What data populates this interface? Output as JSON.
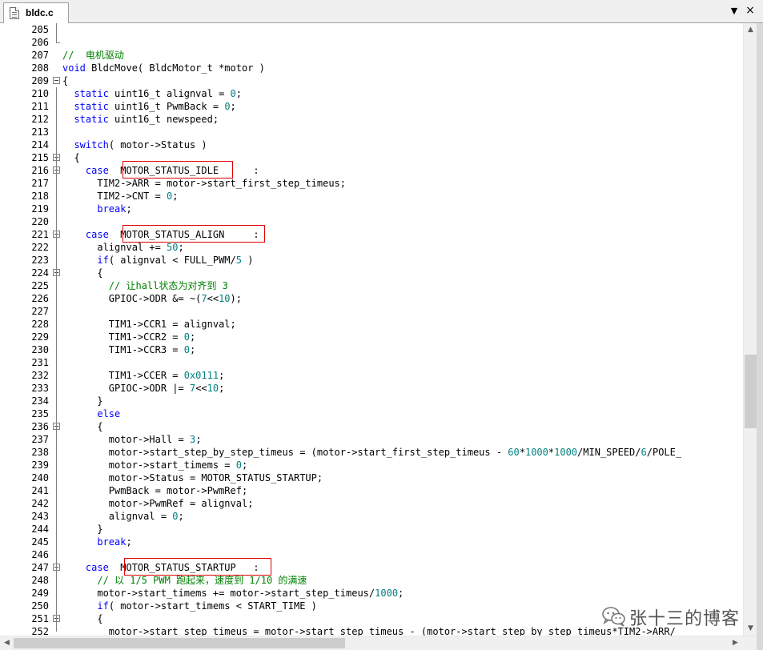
{
  "tab": {
    "label": "bldc.c",
    "menu_icon": "chevron-down-icon",
    "close_icon": "close-icon",
    "menu_glyph": "▼",
    "close_glyph": "×"
  },
  "code_lines": [
    {
      "n": "205",
      "parts": []
    },
    {
      "n": "206",
      "parts": []
    },
    {
      "n": "207",
      "parts": [
        {
          "t": "//  电机驱动",
          "c": "c"
        }
      ]
    },
    {
      "n": "208",
      "parts": [
        {
          "t": "void",
          "c": "k"
        },
        {
          "t": " BldcMove( BldcMotor_t *motor )"
        }
      ]
    },
    {
      "n": "209",
      "parts": [
        {
          "t": "{"
        }
      ]
    },
    {
      "n": "210",
      "parts": [
        {
          "t": "  "
        },
        {
          "t": "static",
          "c": "k"
        },
        {
          "t": " uint16_t alignval = "
        },
        {
          "t": "0",
          "c": "n"
        },
        {
          "t": ";"
        }
      ]
    },
    {
      "n": "211",
      "parts": [
        {
          "t": "  "
        },
        {
          "t": "static",
          "c": "k"
        },
        {
          "t": " uint16_t PwmBack = "
        },
        {
          "t": "0",
          "c": "n"
        },
        {
          "t": ";"
        }
      ]
    },
    {
      "n": "212",
      "parts": [
        {
          "t": "  "
        },
        {
          "t": "static",
          "c": "k"
        },
        {
          "t": " uint16_t newspeed;"
        }
      ]
    },
    {
      "n": "213",
      "parts": []
    },
    {
      "n": "214",
      "parts": [
        {
          "t": "  "
        },
        {
          "t": "switch",
          "c": "k"
        },
        {
          "t": "( motor->Status )"
        }
      ]
    },
    {
      "n": "215",
      "parts": [
        {
          "t": "  {"
        }
      ]
    },
    {
      "n": "216",
      "parts": [
        {
          "t": "    "
        },
        {
          "t": "case",
          "c": "k"
        },
        {
          "t": "  MOTOR_STATUS_IDLE      :"
        }
      ]
    },
    {
      "n": "217",
      "parts": [
        {
          "t": "      TIM2->ARR = motor->start_first_step_timeus;"
        }
      ]
    },
    {
      "n": "218",
      "parts": [
        {
          "t": "      TIM2->CNT = "
        },
        {
          "t": "0",
          "c": "n"
        },
        {
          "t": ";"
        }
      ]
    },
    {
      "n": "219",
      "parts": [
        {
          "t": "      "
        },
        {
          "t": "break",
          "c": "k"
        },
        {
          "t": ";"
        }
      ]
    },
    {
      "n": "220",
      "parts": []
    },
    {
      "n": "221",
      "parts": [
        {
          "t": "    "
        },
        {
          "t": "case",
          "c": "k"
        },
        {
          "t": "  MOTOR_STATUS_ALIGN     :"
        }
      ]
    },
    {
      "n": "222",
      "parts": [
        {
          "t": "      alignval += "
        },
        {
          "t": "50",
          "c": "n"
        },
        {
          "t": ";"
        }
      ]
    },
    {
      "n": "223",
      "parts": [
        {
          "t": "      "
        },
        {
          "t": "if",
          "c": "k"
        },
        {
          "t": "( alignval < FULL_PWM/"
        },
        {
          "t": "5",
          "c": "n"
        },
        {
          "t": " )"
        }
      ]
    },
    {
      "n": "224",
      "parts": [
        {
          "t": "      {"
        }
      ]
    },
    {
      "n": "225",
      "parts": [
        {
          "t": "        "
        },
        {
          "t": "// 让hall状态为对齐到 3",
          "c": "c"
        }
      ]
    },
    {
      "n": "226",
      "parts": [
        {
          "t": "        GPIOC->ODR &= ~("
        },
        {
          "t": "7",
          "c": "n"
        },
        {
          "t": "<<"
        },
        {
          "t": "10",
          "c": "n"
        },
        {
          "t": ");"
        }
      ]
    },
    {
      "n": "227",
      "parts": []
    },
    {
      "n": "228",
      "parts": [
        {
          "t": "        TIM1->CCR1 = alignval;"
        }
      ]
    },
    {
      "n": "229",
      "parts": [
        {
          "t": "        TIM1->CCR2 = "
        },
        {
          "t": "0",
          "c": "n"
        },
        {
          "t": ";"
        }
      ]
    },
    {
      "n": "230",
      "parts": [
        {
          "t": "        TIM1->CCR3 = "
        },
        {
          "t": "0",
          "c": "n"
        },
        {
          "t": ";"
        }
      ]
    },
    {
      "n": "231",
      "parts": []
    },
    {
      "n": "232",
      "parts": [
        {
          "t": "        TIM1->CCER = "
        },
        {
          "t": "0x0111",
          "c": "n"
        },
        {
          "t": ";"
        }
      ]
    },
    {
      "n": "233",
      "parts": [
        {
          "t": "        GPIOC->ODR |= "
        },
        {
          "t": "7",
          "c": "n"
        },
        {
          "t": "<<"
        },
        {
          "t": "10",
          "c": "n"
        },
        {
          "t": ";"
        }
      ]
    },
    {
      "n": "234",
      "parts": [
        {
          "t": "      }"
        }
      ]
    },
    {
      "n": "235",
      "parts": [
        {
          "t": "      "
        },
        {
          "t": "else",
          "c": "k"
        }
      ]
    },
    {
      "n": "236",
      "parts": [
        {
          "t": "      {"
        }
      ]
    },
    {
      "n": "237",
      "parts": [
        {
          "t": "        motor->Hall = "
        },
        {
          "t": "3",
          "c": "n"
        },
        {
          "t": ";"
        }
      ]
    },
    {
      "n": "238",
      "parts": [
        {
          "t": "        motor->start_step_by_step_timeus = (motor->start_first_step_timeus - "
        },
        {
          "t": "60",
          "c": "n"
        },
        {
          "t": "*"
        },
        {
          "t": "1000",
          "c": "n"
        },
        {
          "t": "*"
        },
        {
          "t": "1000",
          "c": "n"
        },
        {
          "t": "/MIN_SPEED/"
        },
        {
          "t": "6",
          "c": "n"
        },
        {
          "t": "/POLE_"
        }
      ]
    },
    {
      "n": "239",
      "parts": [
        {
          "t": "        motor->start_timems = "
        },
        {
          "t": "0",
          "c": "n"
        },
        {
          "t": ";"
        }
      ]
    },
    {
      "n": "240",
      "parts": [
        {
          "t": "        motor->Status = MOTOR_STATUS_STARTUP;"
        }
      ]
    },
    {
      "n": "241",
      "parts": [
        {
          "t": "        PwmBack = motor->PwmRef;"
        }
      ]
    },
    {
      "n": "242",
      "parts": [
        {
          "t": "        motor->PwmRef = alignval;"
        }
      ]
    },
    {
      "n": "243",
      "parts": [
        {
          "t": "        alignval = "
        },
        {
          "t": "0",
          "c": "n"
        },
        {
          "t": ";"
        }
      ]
    },
    {
      "n": "244",
      "parts": [
        {
          "t": "      }"
        }
      ]
    },
    {
      "n": "245",
      "parts": [
        {
          "t": "      "
        },
        {
          "t": "break",
          "c": "k"
        },
        {
          "t": ";"
        }
      ]
    },
    {
      "n": "246",
      "parts": []
    },
    {
      "n": "247",
      "parts": [
        {
          "t": "    "
        },
        {
          "t": "case",
          "c": "k"
        },
        {
          "t": "  MOTOR_STATUS_STARTUP   :"
        }
      ]
    },
    {
      "n": "248",
      "parts": [
        {
          "t": "      "
        },
        {
          "t": "// 以 1/5 PWM 跑起来，速度到 1/10 的满速",
          "c": "c"
        }
      ]
    },
    {
      "n": "249",
      "parts": [
        {
          "t": "      motor->start_timems += motor->start_step_timeus/"
        },
        {
          "t": "1000",
          "c": "n"
        },
        {
          "t": ";"
        }
      ]
    },
    {
      "n": "250",
      "parts": [
        {
          "t": "      "
        },
        {
          "t": "if",
          "c": "k"
        },
        {
          "t": "( motor->start_timems < START_TIME )"
        }
      ]
    },
    {
      "n": "251",
      "parts": [
        {
          "t": "      {"
        }
      ]
    },
    {
      "n": "252",
      "parts": [
        {
          "t": "        motor->start_step_timeus = motor->start_step_timeus - (motor->start_step_by_step_timeus*TIM2->ARR/"
        }
      ]
    }
  ],
  "watermark": {
    "text": "张十三的博客",
    "icon": "wechat-icon"
  },
  "scrollbar": {
    "up_glyph": "▲",
    "down_glyph": "▼",
    "left_glyph": "◀",
    "right_glyph": "▶",
    "up_icon": "scroll-up-arrow-icon",
    "down_icon": "scroll-down-arrow-icon",
    "left_icon": "scroll-left-arrow-icon",
    "right_icon": "scroll-right-arrow-icon"
  },
  "fold_markers": [
    "209",
    "215",
    "216",
    "221",
    "224",
    "236",
    "247",
    "251"
  ],
  "highlight_boxes": [
    "MOTOR_STATUS_IDLE",
    "MOTOR_STATUS_ALIGN",
    "MOTOR_STATUS_STARTUP"
  ],
  "colors": {
    "keyword": "#0000ff",
    "number": "#008080",
    "comment": "#008000",
    "highlight_box": "#e00000"
  }
}
